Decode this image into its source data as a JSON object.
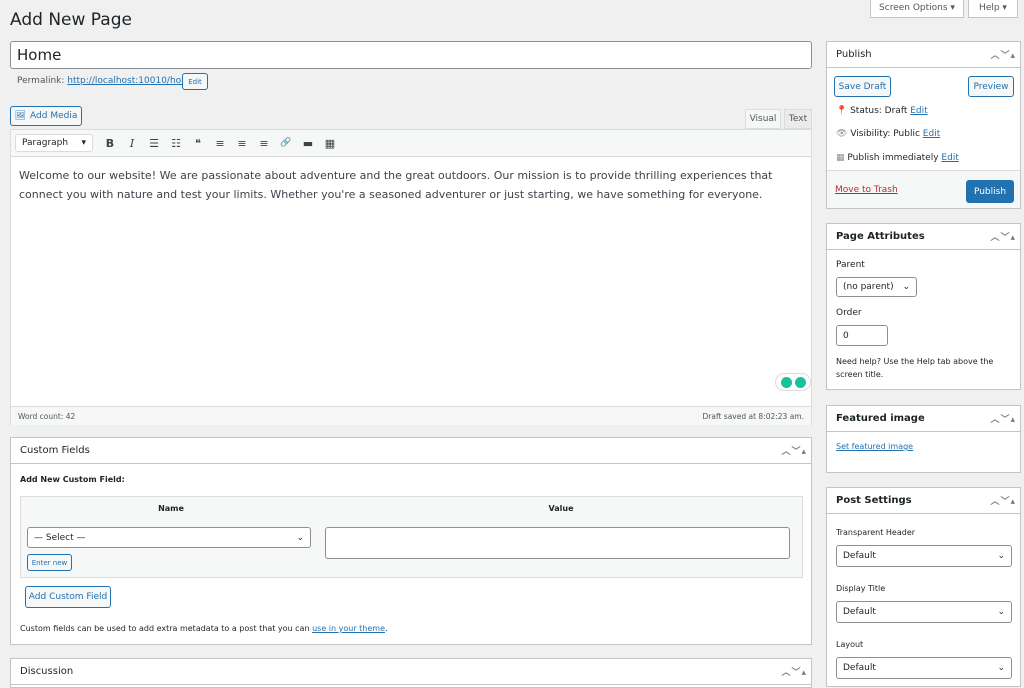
{
  "header": {
    "title": "Add New Page",
    "screen_options": "Screen Options ▾",
    "help": "Help ▾"
  },
  "post": {
    "title": "Home",
    "permalink_label": "Permalink:",
    "permalink": "http://localhost:10010/home/",
    "edit": "Edit"
  },
  "editor": {
    "add_media": "Add Media",
    "tab_visual": "Visual",
    "tab_text": "Text",
    "format": "Paragraph",
    "toolbar": [
      "B",
      "I",
      "☰",
      "☷",
      "❝",
      "≡",
      "≡",
      "≡",
      "🔗",
      "▬",
      "▦"
    ],
    "content": "Welcome to our website! We are passionate about adventure and the great outdoors. Our mission is to provide thrilling experiences that connect you with nature and test your limits. Whether you're a seasoned adventurer or just starting, we have something for everyone.",
    "word_count": "Word count: 42",
    "draft_saved": "Draft saved at 8:02:23 am."
  },
  "custom_fields": {
    "title": "Custom Fields",
    "add_new": "Add New Custom Field:",
    "col_name": "Name",
    "col_value": "Value",
    "select": "— Select —",
    "enter_new": "Enter new",
    "add_button": "Add Custom Field",
    "help_pre": "Custom fields can be used to add extra metadata to a post that you can ",
    "help_link": "use in your theme",
    "help_post": "."
  },
  "discussion": {
    "title": "Discussion"
  },
  "publish": {
    "title": "Publish",
    "save_draft": "Save Draft",
    "preview": "Preview",
    "status": "Status: ",
    "status_val": "Draft",
    "visibility": "Visibility: ",
    "visibility_val": "Public",
    "publish_label": "Publish ",
    "publish_val": "immediately",
    "edit": "Edit",
    "trash": "Move to Trash",
    "publish_btn": "Publish"
  },
  "page_attributes": {
    "title": "Page Attributes",
    "parent": "Parent",
    "parent_val": "(no parent)",
    "order": "Order",
    "order_val": "0",
    "help": "Need help? Use the Help tab above the screen title."
  },
  "featured": {
    "title": "Featured image",
    "link": "Set featured image"
  },
  "post_settings": {
    "title": "Post Settings",
    "transparent": "Transparent Header",
    "transparent_val": "Default",
    "display_title": "Display Title",
    "display_title_val": "Default",
    "layout": "Layout",
    "layout_val": "Default"
  },
  "colors": {
    "accent": "#2271b1"
  }
}
